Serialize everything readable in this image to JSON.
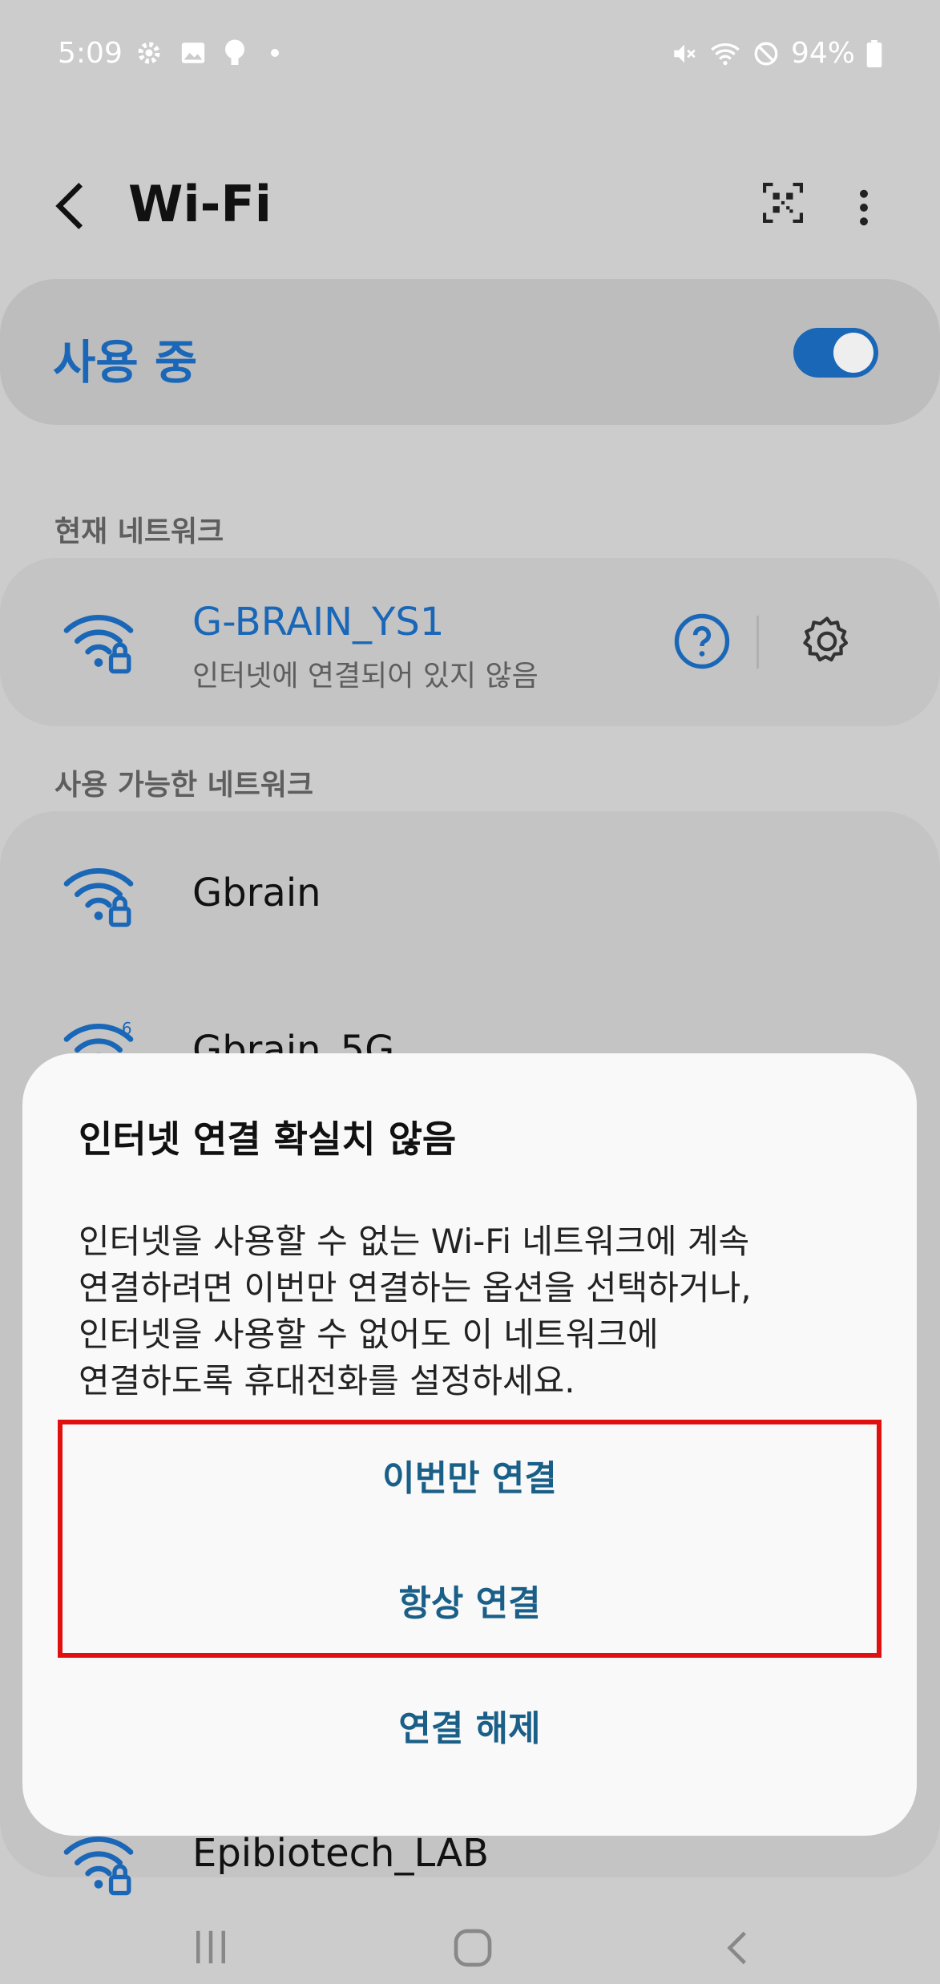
{
  "status_bar": {
    "time": "5:09",
    "battery": "94%"
  },
  "header": {
    "title": "Wi-Fi"
  },
  "master": {
    "label": "사용 중",
    "enabled": true
  },
  "current_section": {
    "label": "현재 네트워크"
  },
  "current_network": {
    "name": "G-BRAIN_YS1",
    "status": "인터넷에 연결되어 있지 않음"
  },
  "available_section": {
    "label": "사용 가능한 네트워크"
  },
  "networks": [
    {
      "name": "Gbrain"
    },
    {
      "name": "Gbrain_5G"
    },
    {
      "name": "Epibiotech_LAB"
    }
  ],
  "dialog": {
    "title": "인터넷 연결 확실치 않음",
    "body_lines": [
      "인터넷을 사용할 수 없는 Wi-Fi 네트워크에 계속",
      "연결하려면 이번만 연결하는 옵션을 선택하거나,",
      "인터넷을 사용할 수 없어도 이 네트워크에",
      "연결하도록 휴대전화를 설정하세요."
    ],
    "btn_once": "이번만 연결",
    "btn_always": "항상 연결",
    "btn_disconnect": "연결 해제"
  },
  "colors": {
    "accent": "#1a67b8",
    "dialog_button": "#1a5f87",
    "highlight": "#e01010"
  }
}
